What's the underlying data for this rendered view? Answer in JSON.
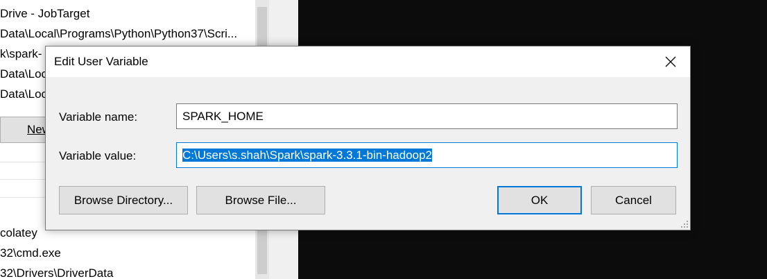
{
  "background": {
    "path_rows": [
      "Drive - JobTarget",
      "Data\\Local\\Programs\\Python\\Python37\\Scri...",
      "k\\spark-",
      "Data\\Loc",
      "Data\\Loc"
    ],
    "new_button_label": "New",
    "lower_rows": [
      "colatey",
      "32\\cmd.exe",
      "32\\Drivers\\DriverData"
    ]
  },
  "dialog": {
    "title": "Edit User Variable",
    "name_label": "Variable name:",
    "name_value": "SPARK_HOME",
    "value_label": "Variable value:",
    "value_value": "C:\\Users\\s.shah\\Spark\\spark-3.3.1-bin-hadoop2",
    "browse_directory": "Browse Directory...",
    "browse_file": "Browse File...",
    "ok": "OK",
    "cancel": "Cancel"
  },
  "colors": {
    "accent": "#0078d7",
    "dialog_bg": "#f0f0f0",
    "console_bg": "#0c0c0c"
  }
}
